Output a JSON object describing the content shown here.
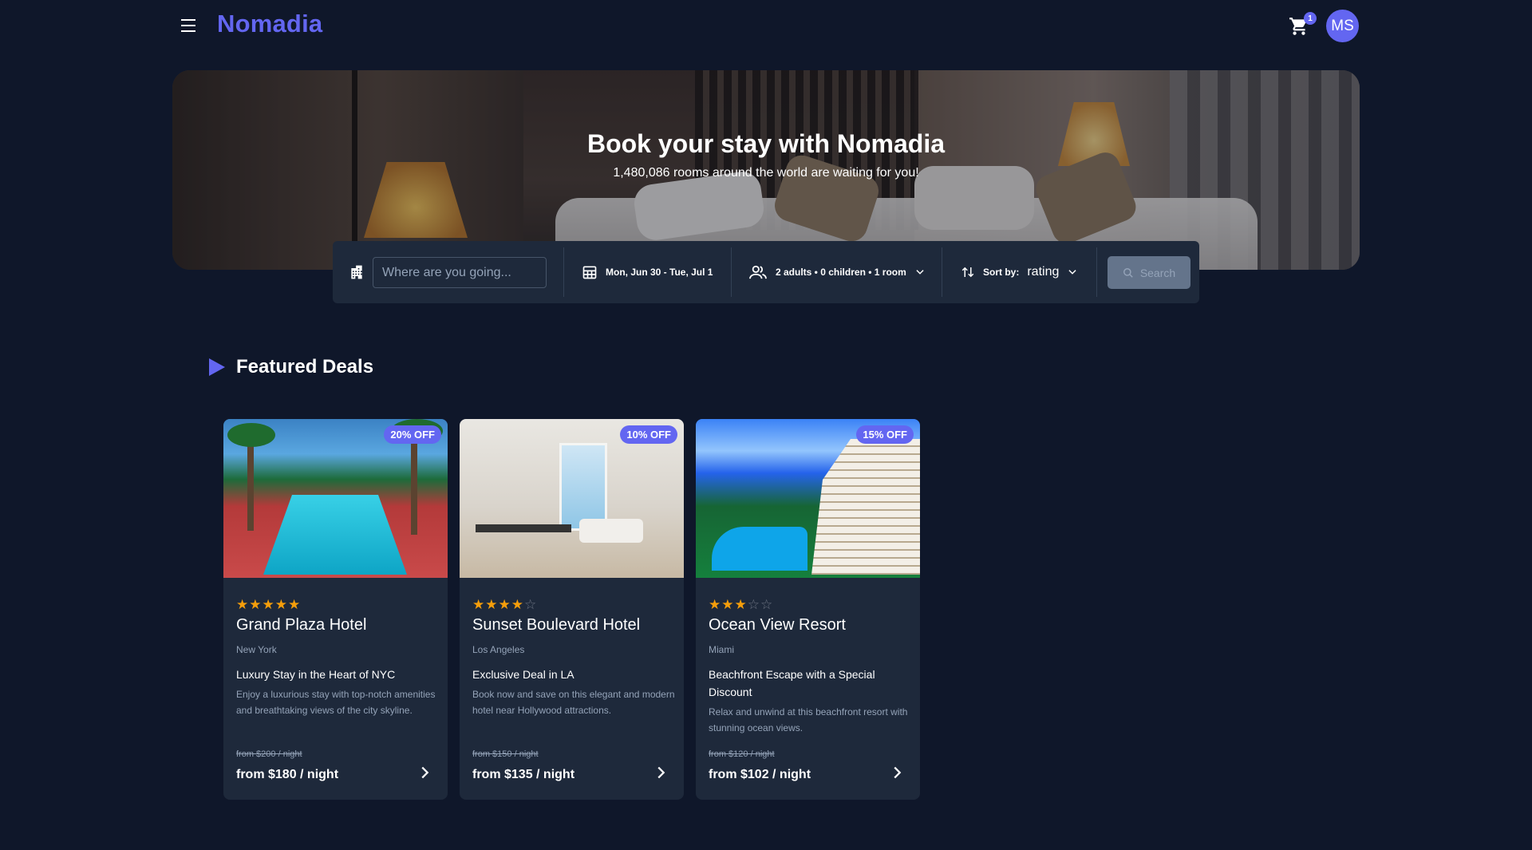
{
  "header": {
    "brand": "Nomadia",
    "cart_count": "1",
    "avatar_initials": "MS"
  },
  "hero": {
    "title": "Book your stay with Nomadia",
    "subtitle": "1,480,086 rooms around the world are waiting for you!"
  },
  "search": {
    "placeholder": "Where are you going...",
    "dates": "Mon, Jun 30 - Tue, Jul 1",
    "guests": "2 adults • 0 children • 1 room",
    "sort_label": "Sort by:",
    "sort_value": "rating",
    "button": "Search"
  },
  "featured": {
    "title": "Featured Deals",
    "cards": [
      {
        "badge": "20% OFF",
        "stars_filled": "★★★★★",
        "stars_empty": "",
        "rating": 5,
        "name": "Grand Plaza Hotel",
        "city": "New York",
        "deal": "Luxury Stay in the Heart of NYC",
        "desc": "Enjoy a luxurious stay with top-notch amenities and breathtaking views of the city skyline.",
        "old_price": "from $200 / night",
        "new_price": "from $180 / night"
      },
      {
        "badge": "10% OFF",
        "stars_filled": "★★★★",
        "stars_empty": "☆",
        "rating": 4,
        "name": "Sunset Boulevard Hotel",
        "city": "Los Angeles",
        "deal": "Exclusive Deal in LA",
        "desc": "Book now and save on this elegant and modern hotel near Hollywood attractions.",
        "old_price": "from $150 / night",
        "new_price": "from $135 / night"
      },
      {
        "badge": "15% OFF",
        "stars_filled": "★★★",
        "stars_empty": "☆☆",
        "rating": 3,
        "name": "Ocean View Resort",
        "city": "Miami",
        "deal": "Beachfront Escape with a Special Discount",
        "desc": "Relax and unwind at this beachfront resort with stunning ocean views.",
        "old_price": "from $120 / night",
        "new_price": "from $102 / night"
      }
    ]
  },
  "colors": {
    "background": "#0f172a",
    "surface": "#1e293b",
    "accent": "#6366f1",
    "star": "#f59e0b"
  },
  "icons": [
    "menu-icon",
    "cart-icon",
    "hotel-icon",
    "calendar-icon",
    "guests-icon",
    "sort-icon",
    "chevron-down-icon",
    "search-icon",
    "chevron-right-icon"
  ]
}
